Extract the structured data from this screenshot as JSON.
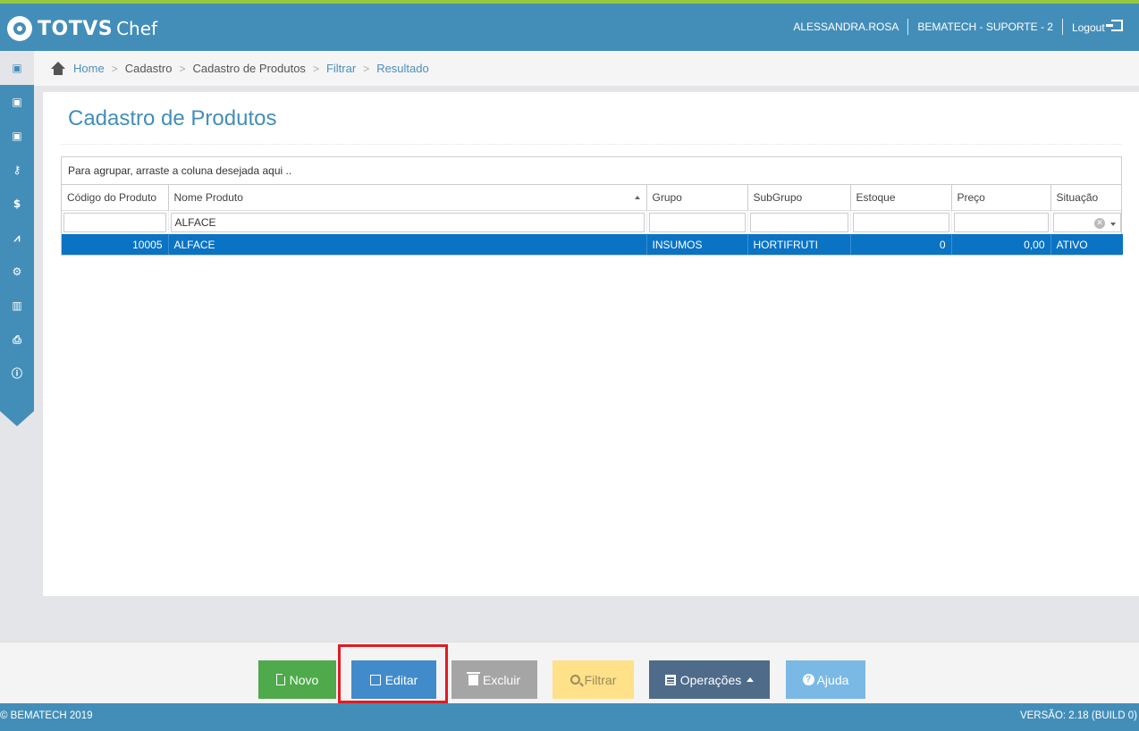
{
  "header": {
    "brand": "TOTVS",
    "brand_suffix": "Chef",
    "username": "ALESSANDRA.ROSA",
    "company": "BEMATECH - SUPORTE - 2",
    "logout_label": "Logout"
  },
  "sidebar": {
    "items": [
      {
        "icon": "contact-card-icon",
        "glyph": "▣"
      },
      {
        "icon": "contact-card-icon",
        "glyph": "▣"
      },
      {
        "icon": "contact-card-icon",
        "glyph": "▣"
      },
      {
        "icon": "key-icon",
        "glyph": "⚷"
      },
      {
        "icon": "money-icon",
        "glyph": "$"
      },
      {
        "icon": "chart-icon",
        "glyph": "⩘"
      },
      {
        "icon": "gear-icon",
        "glyph": "⚙"
      },
      {
        "icon": "barcode-icon",
        "glyph": "▥"
      },
      {
        "icon": "print-icon",
        "glyph": "⎙"
      },
      {
        "icon": "info-icon",
        "glyph": "ⓘ"
      }
    ]
  },
  "breadcrumb": {
    "home": "Home",
    "items": [
      "Cadastro",
      "Cadastro de Produtos",
      "Filtrar",
      "Resultado"
    ],
    "separator": ">"
  },
  "page": {
    "title": "Cadastro de Produtos"
  },
  "grid": {
    "group_hint": "Para agrupar, arraste a coluna desejada aqui ..",
    "columns": [
      "Código do Produto",
      "Nome Produto",
      "Grupo",
      "SubGrupo",
      "Estoque",
      "Preço",
      "Situação"
    ],
    "filters": {
      "codigo": "",
      "nome": "ALFACE",
      "grupo": "",
      "subgrupo": "",
      "estoque": "",
      "preco": "",
      "situacao": ""
    },
    "rows": [
      {
        "codigo": "10005",
        "nome": "ALFACE",
        "grupo": "INSUMOS",
        "subgrupo": "HORTIFRUTI",
        "estoque": "0",
        "preco": "0,00",
        "situacao": "ATIVO"
      }
    ]
  },
  "toolbar": {
    "novo": "Novo",
    "editar": "Editar",
    "excluir": "Excluir",
    "filtrar": "Filtrar",
    "operacoes": "Operações",
    "ajuda": "Ajuda"
  },
  "footer": {
    "copyright": "© BEMATECH 2019",
    "version": "VERSÃO: 2.18 (BUILD 0)"
  },
  "colors": {
    "brand_blue": "#438eb9",
    "accent_green": "#95c93d",
    "selected_row": "#0a73c4",
    "highlight_red": "#e01b24"
  }
}
